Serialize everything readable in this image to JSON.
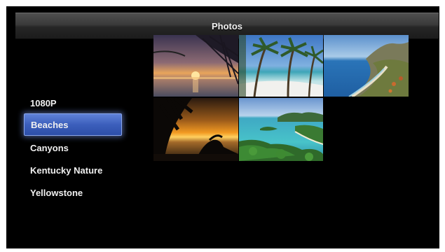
{
  "header": {
    "title": "Photos"
  },
  "menu": {
    "items": [
      {
        "label": "1080P",
        "selected": false
      },
      {
        "label": "Beaches",
        "selected": true
      },
      {
        "label": "Canyons",
        "selected": false
      },
      {
        "label": "Kentucky Nature",
        "selected": false
      },
      {
        "label": "Yellowstone",
        "selected": false
      }
    ]
  },
  "grid": {
    "thumbnails": [
      {
        "subject": "sunset-dunes-grass"
      },
      {
        "subject": "palm-beach"
      },
      {
        "subject": "coastline-mountains"
      },
      {
        "subject": "sunset-silhouette"
      },
      {
        "subject": "tropical-bay-island"
      }
    ]
  },
  "colors": {
    "background": "#000000",
    "selection": "#3c5fbc",
    "text": "#f0f0f0"
  }
}
